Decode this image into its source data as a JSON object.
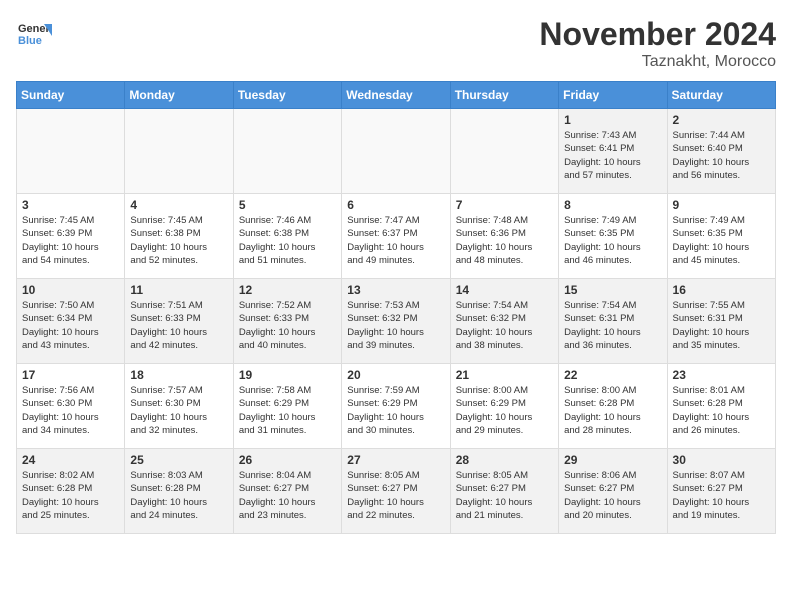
{
  "header": {
    "logo_line1": "General",
    "logo_line2": "Blue",
    "month_title": "November 2024",
    "subtitle": "Taznakht, Morocco"
  },
  "weekdays": [
    "Sunday",
    "Monday",
    "Tuesday",
    "Wednesday",
    "Thursday",
    "Friday",
    "Saturday"
  ],
  "weeks": [
    [
      {
        "day": "",
        "info": ""
      },
      {
        "day": "",
        "info": ""
      },
      {
        "day": "",
        "info": ""
      },
      {
        "day": "",
        "info": ""
      },
      {
        "day": "",
        "info": ""
      },
      {
        "day": "1",
        "info": "Sunrise: 7:43 AM\nSunset: 6:41 PM\nDaylight: 10 hours\nand 57 minutes."
      },
      {
        "day": "2",
        "info": "Sunrise: 7:44 AM\nSunset: 6:40 PM\nDaylight: 10 hours\nand 56 minutes."
      }
    ],
    [
      {
        "day": "3",
        "info": "Sunrise: 7:45 AM\nSunset: 6:39 PM\nDaylight: 10 hours\nand 54 minutes."
      },
      {
        "day": "4",
        "info": "Sunrise: 7:45 AM\nSunset: 6:38 PM\nDaylight: 10 hours\nand 52 minutes."
      },
      {
        "day": "5",
        "info": "Sunrise: 7:46 AM\nSunset: 6:38 PM\nDaylight: 10 hours\nand 51 minutes."
      },
      {
        "day": "6",
        "info": "Sunrise: 7:47 AM\nSunset: 6:37 PM\nDaylight: 10 hours\nand 49 minutes."
      },
      {
        "day": "7",
        "info": "Sunrise: 7:48 AM\nSunset: 6:36 PM\nDaylight: 10 hours\nand 48 minutes."
      },
      {
        "day": "8",
        "info": "Sunrise: 7:49 AM\nSunset: 6:35 PM\nDaylight: 10 hours\nand 46 minutes."
      },
      {
        "day": "9",
        "info": "Sunrise: 7:49 AM\nSunset: 6:35 PM\nDaylight: 10 hours\nand 45 minutes."
      }
    ],
    [
      {
        "day": "10",
        "info": "Sunrise: 7:50 AM\nSunset: 6:34 PM\nDaylight: 10 hours\nand 43 minutes."
      },
      {
        "day": "11",
        "info": "Sunrise: 7:51 AM\nSunset: 6:33 PM\nDaylight: 10 hours\nand 42 minutes."
      },
      {
        "day": "12",
        "info": "Sunrise: 7:52 AM\nSunset: 6:33 PM\nDaylight: 10 hours\nand 40 minutes."
      },
      {
        "day": "13",
        "info": "Sunrise: 7:53 AM\nSunset: 6:32 PM\nDaylight: 10 hours\nand 39 minutes."
      },
      {
        "day": "14",
        "info": "Sunrise: 7:54 AM\nSunset: 6:32 PM\nDaylight: 10 hours\nand 38 minutes."
      },
      {
        "day": "15",
        "info": "Sunrise: 7:54 AM\nSunset: 6:31 PM\nDaylight: 10 hours\nand 36 minutes."
      },
      {
        "day": "16",
        "info": "Sunrise: 7:55 AM\nSunset: 6:31 PM\nDaylight: 10 hours\nand 35 minutes."
      }
    ],
    [
      {
        "day": "17",
        "info": "Sunrise: 7:56 AM\nSunset: 6:30 PM\nDaylight: 10 hours\nand 34 minutes."
      },
      {
        "day": "18",
        "info": "Sunrise: 7:57 AM\nSunset: 6:30 PM\nDaylight: 10 hours\nand 32 minutes."
      },
      {
        "day": "19",
        "info": "Sunrise: 7:58 AM\nSunset: 6:29 PM\nDaylight: 10 hours\nand 31 minutes."
      },
      {
        "day": "20",
        "info": "Sunrise: 7:59 AM\nSunset: 6:29 PM\nDaylight: 10 hours\nand 30 minutes."
      },
      {
        "day": "21",
        "info": "Sunrise: 8:00 AM\nSunset: 6:29 PM\nDaylight: 10 hours\nand 29 minutes."
      },
      {
        "day": "22",
        "info": "Sunrise: 8:00 AM\nSunset: 6:28 PM\nDaylight: 10 hours\nand 28 minutes."
      },
      {
        "day": "23",
        "info": "Sunrise: 8:01 AM\nSunset: 6:28 PM\nDaylight: 10 hours\nand 26 minutes."
      }
    ],
    [
      {
        "day": "24",
        "info": "Sunrise: 8:02 AM\nSunset: 6:28 PM\nDaylight: 10 hours\nand 25 minutes."
      },
      {
        "day": "25",
        "info": "Sunrise: 8:03 AM\nSunset: 6:28 PM\nDaylight: 10 hours\nand 24 minutes."
      },
      {
        "day": "26",
        "info": "Sunrise: 8:04 AM\nSunset: 6:27 PM\nDaylight: 10 hours\nand 23 minutes."
      },
      {
        "day": "27",
        "info": "Sunrise: 8:05 AM\nSunset: 6:27 PM\nDaylight: 10 hours\nand 22 minutes."
      },
      {
        "day": "28",
        "info": "Sunrise: 8:05 AM\nSunset: 6:27 PM\nDaylight: 10 hours\nand 21 minutes."
      },
      {
        "day": "29",
        "info": "Sunrise: 8:06 AM\nSunset: 6:27 PM\nDaylight: 10 hours\nand 20 minutes."
      },
      {
        "day": "30",
        "info": "Sunrise: 8:07 AM\nSunset: 6:27 PM\nDaylight: 10 hours\nand 19 minutes."
      }
    ]
  ]
}
